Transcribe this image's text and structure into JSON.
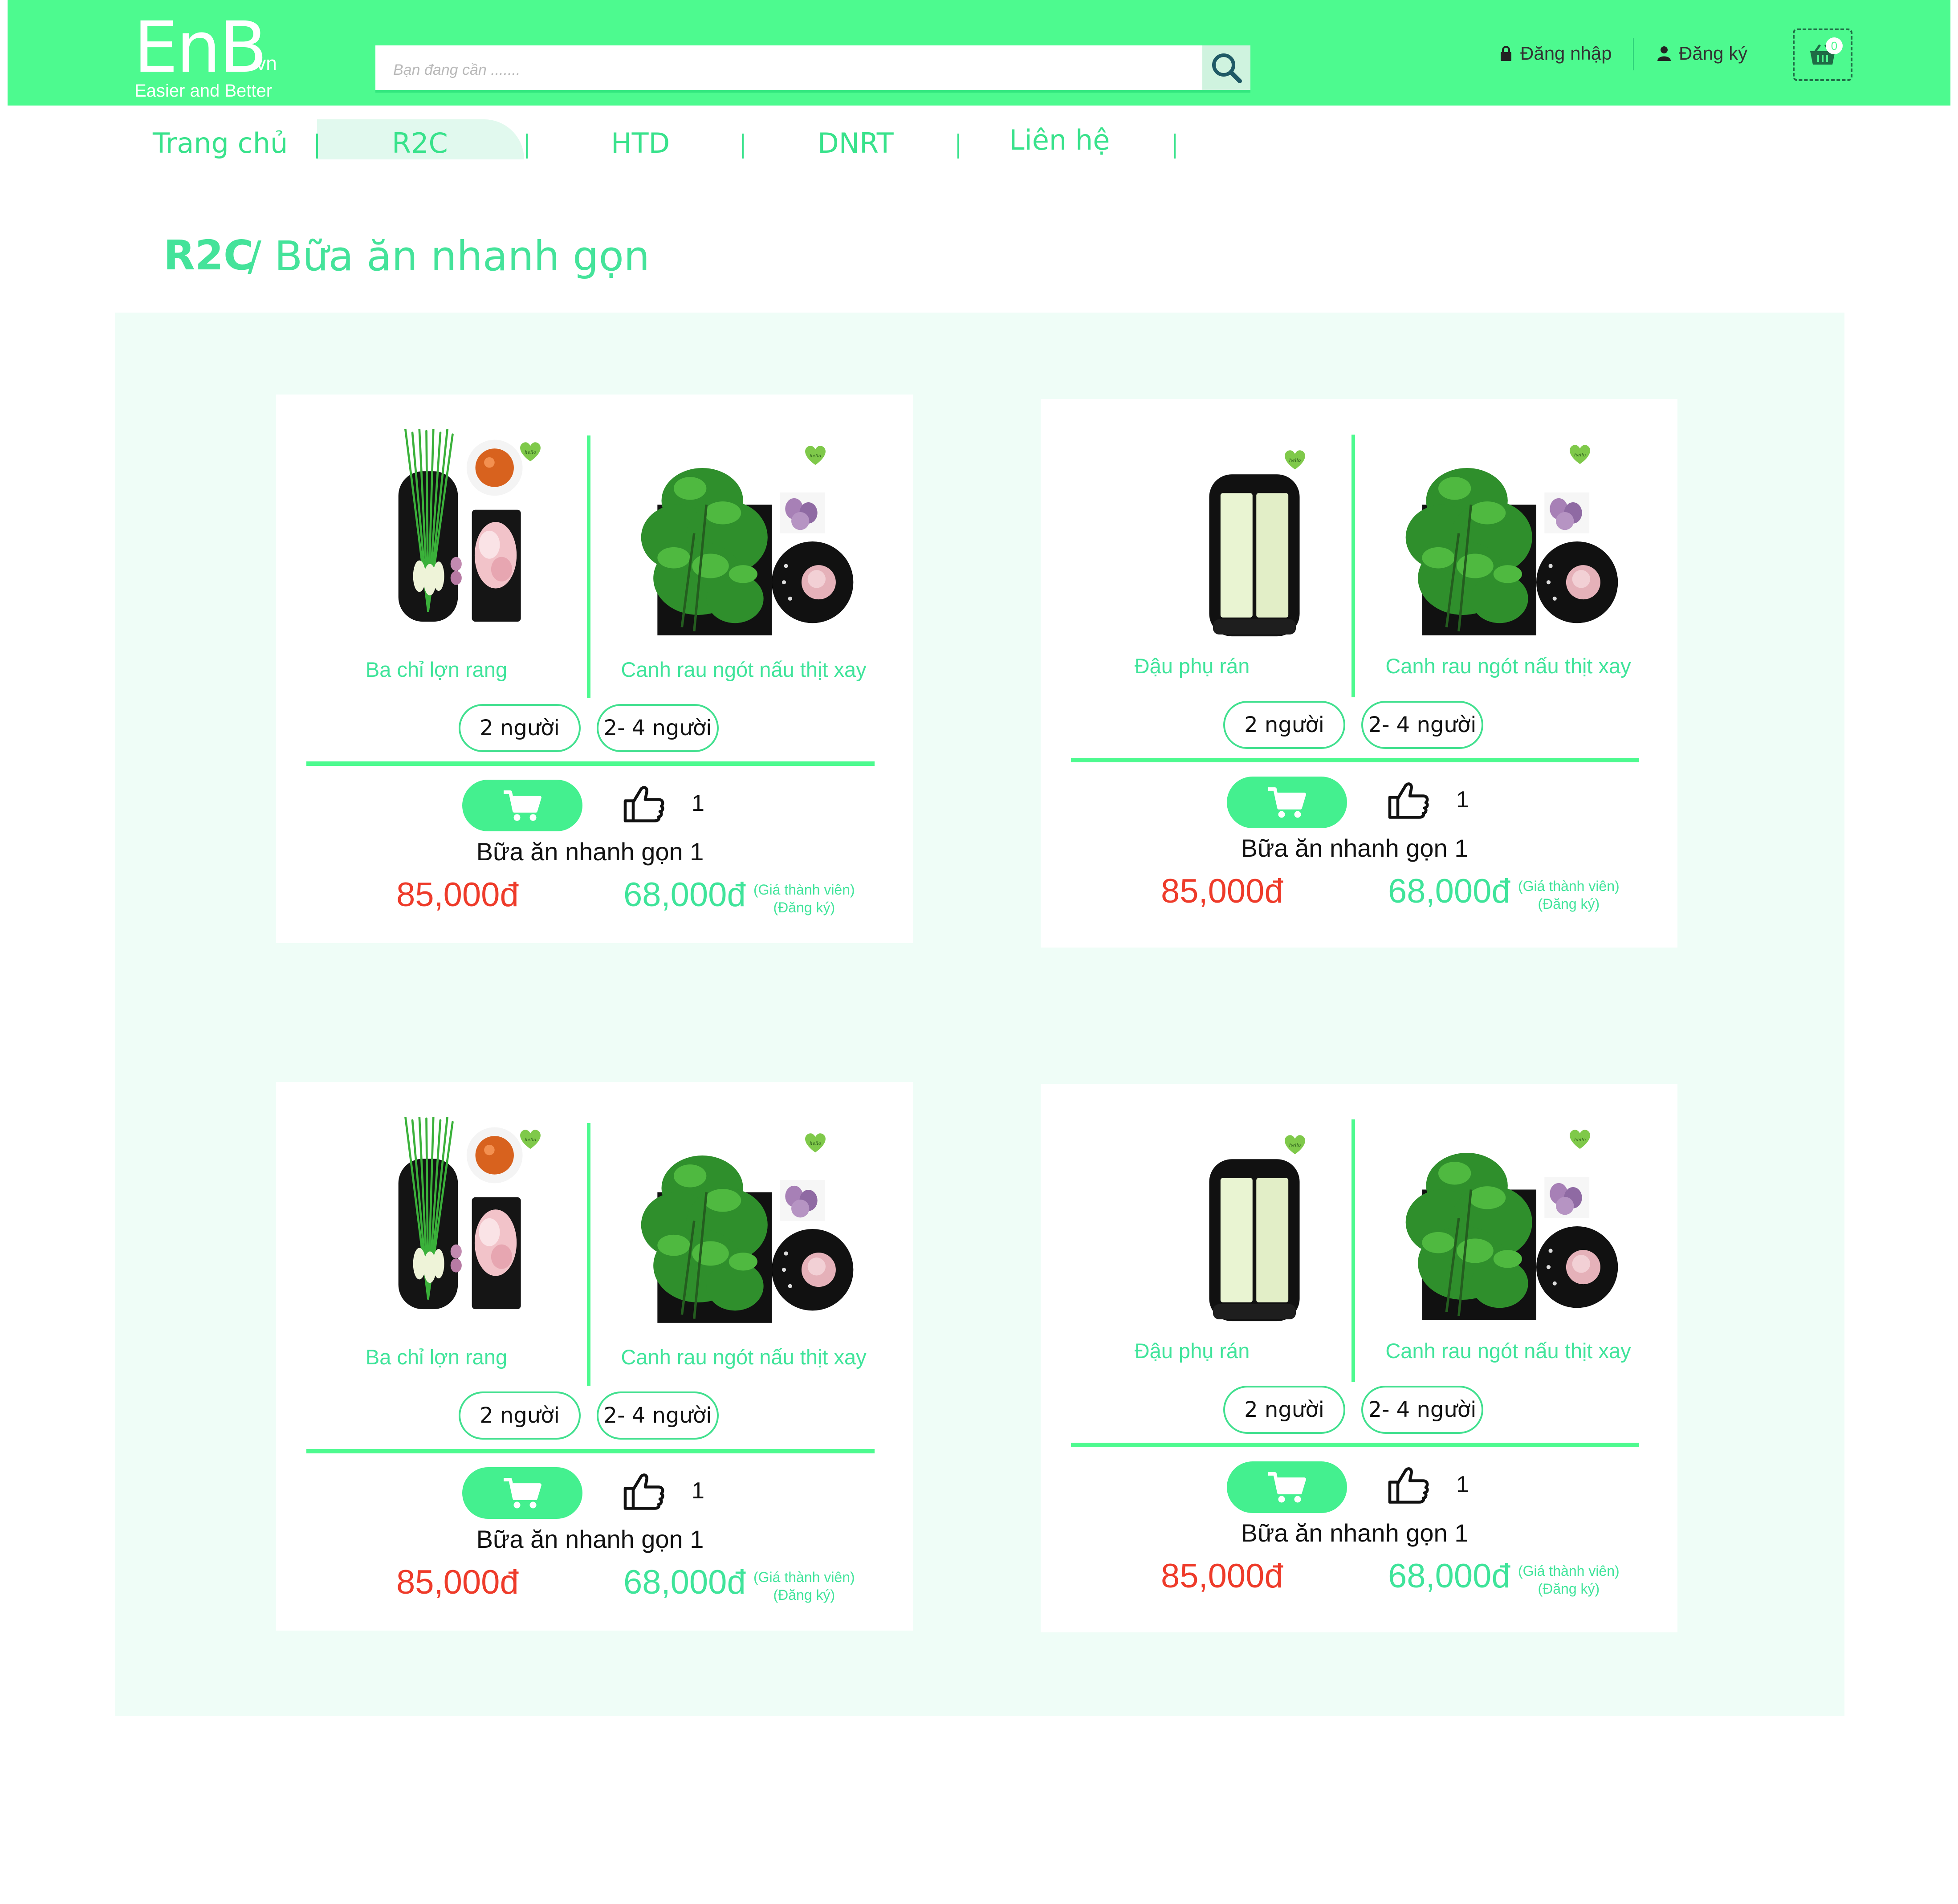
{
  "header": {
    "logo": "EnB",
    "logo_suffix": ".vn",
    "tagline": "Easier and Better",
    "search_placeholder": "Bạn đang cần .......",
    "login_label": "Đăng nhập",
    "register_label": "Đăng ký",
    "cart_count": "0"
  },
  "nav": {
    "items": [
      {
        "label": "Trang chủ"
      },
      {
        "label": "R2C"
      },
      {
        "label": "HTD"
      },
      {
        "label": "DNRT"
      },
      {
        "label": "Liên hệ"
      }
    ],
    "active": "R2C"
  },
  "page": {
    "title_prefix": "R2C",
    "title_rest": "/ Bữa ăn nhanh gọn"
  },
  "cards": [
    {
      "dish1": "Ba chỉ lợn rang",
      "dish2": "Canh rau ngót nấu thịt xay",
      "option1": "2 người",
      "option2": "2- 4 người",
      "likes": "1",
      "pack_name": "Bữa ăn nhanh gọn 1",
      "old_price": "85,000đ",
      "new_price": "68,000đ",
      "member_note_1": "(Giá thành viên)",
      "member_note_2": "(Đăng ký)"
    },
    {
      "dish1": "Đậu phụ rán",
      "dish2": "Canh rau ngót nấu thịt xay",
      "option1": "2 người",
      "option2": "2- 4 người",
      "likes": "1",
      "pack_name": "Bữa ăn nhanh gọn 1",
      "old_price": "85,000đ",
      "new_price": "68,000đ",
      "member_note_1": "(Giá thành viên)",
      "member_note_2": "(Đăng ký)"
    },
    {
      "dish1": "Ba chỉ lợn rang",
      "dish2": "Canh rau ngót nấu thịt xay",
      "option1": "2 người",
      "option2": "2- 4 người",
      "likes": "1",
      "pack_name": "Bữa ăn nhanh gọn 1",
      "old_price": "85,000đ",
      "new_price": "68,000đ",
      "member_note_1": "(Giá thành viên)",
      "member_note_2": "(Đăng ký)"
    },
    {
      "dish1": "Đậu phụ rán",
      "dish2": "Canh rau ngót nấu thịt xay",
      "option1": "2 người",
      "option2": "2- 4 người",
      "likes": "1",
      "pack_name": "Bữa ăn nhanh gọn 1",
      "old_price": "85,000đ",
      "new_price": "68,000đ",
      "member_note_1": "(Giá thành viên)",
      "member_note_2": "(Đăng ký)"
    }
  ],
  "colors": {
    "brand": "#4dfa8f",
    "accent_text": "#3fe49a",
    "old_price": "#ee3b2a",
    "content_bg": "#effdf7"
  },
  "icons": [
    "search-icon",
    "lock-icon",
    "user-icon",
    "basket-icon",
    "cart-icon",
    "thumbs-up-icon",
    "brand-badge-icon"
  ]
}
